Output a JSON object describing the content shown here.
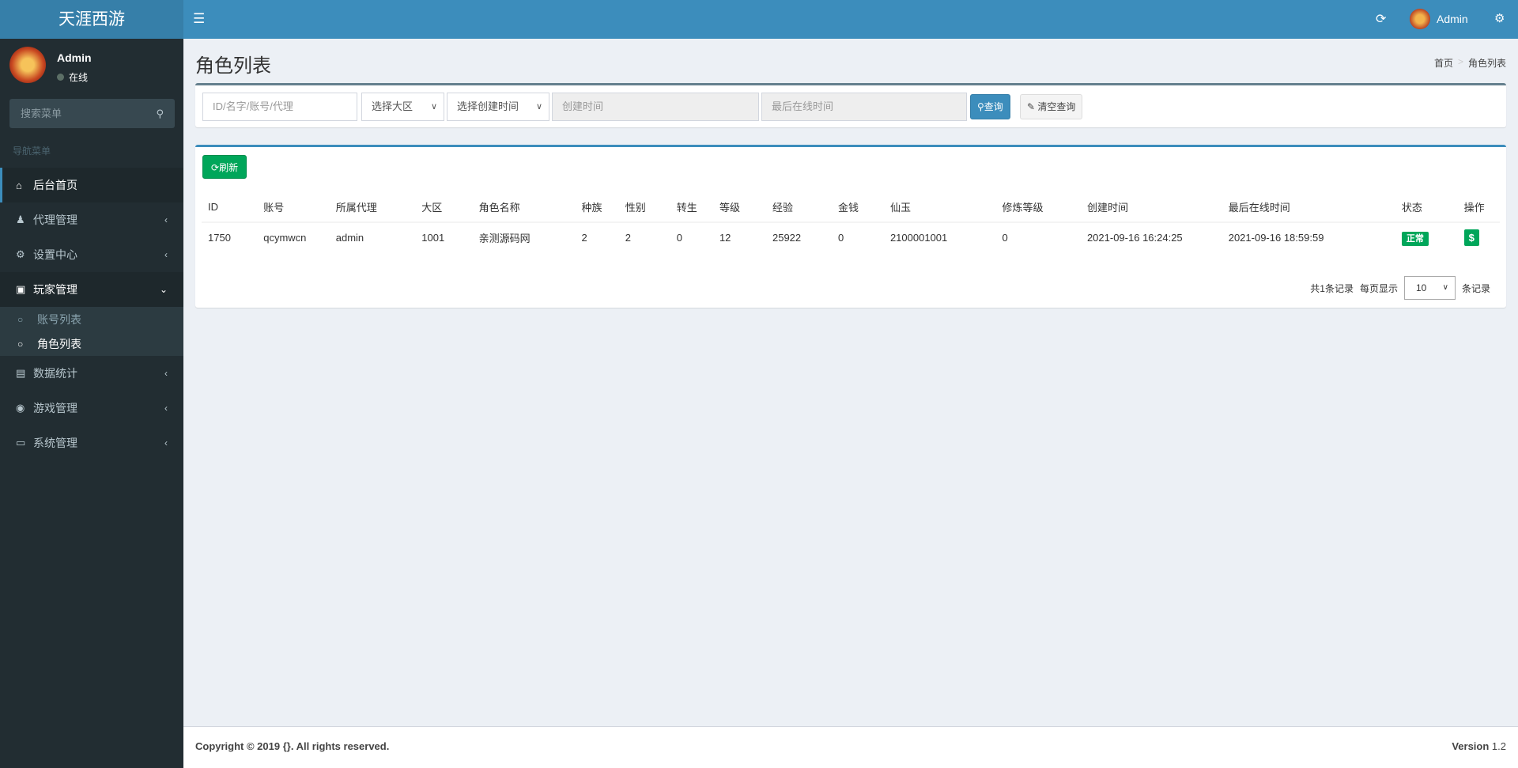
{
  "header": {
    "logo": "天涯西游",
    "user": "Admin"
  },
  "sidebar": {
    "user": {
      "name": "Admin",
      "status": "在线"
    },
    "search_placeholder": "搜索菜单",
    "section": "导航菜单",
    "items": [
      {
        "label": "后台首页",
        "icon": "home-icon"
      },
      {
        "label": "代理管理",
        "icon": "users-icon"
      },
      {
        "label": "设置中心",
        "icon": "gears-icon"
      },
      {
        "label": "玩家管理",
        "icon": "user-card-icon"
      },
      {
        "label": "数据统计",
        "icon": "area-chart-icon"
      },
      {
        "label": "游戏管理",
        "icon": "gamepad-icon"
      },
      {
        "label": "系统管理",
        "icon": "desktop-icon"
      }
    ],
    "sub_items": [
      {
        "label": "账号列表"
      },
      {
        "label": "角色列表"
      }
    ]
  },
  "page": {
    "title": "角色列表",
    "breadcrumb": [
      "首页",
      "角色列表"
    ]
  },
  "filters": {
    "keyword_placeholder": "ID/名字/账号/代理",
    "zone": "选择大区",
    "create_time_select": "选择创建时间",
    "create_time_placeholder": "创建时间",
    "last_online_placeholder": "最后在线时间",
    "search": "查询",
    "clear": "清空查询"
  },
  "toolbar": {
    "refresh": "刷新"
  },
  "table": {
    "headers": [
      "ID",
      "账号",
      "所属代理",
      "大区",
      "角色名称",
      "种族",
      "性别",
      "转生",
      "等级",
      "经验",
      "金钱",
      "仙玉",
      "修炼等级",
      "创建时间",
      "最后在线时间",
      "状态",
      "操作"
    ],
    "rows": [
      [
        "1750",
        "qcymwcn",
        "admin",
        "1001",
        "亲测源码网",
        "2",
        "2",
        "0",
        "12",
        "25922",
        "0",
        "2100001001",
        "0",
        "2021-09-16 16:24:25",
        "2021-09-16 18:59:59",
        "正常",
        "$"
      ]
    ]
  },
  "pagination": {
    "total": "共1条记录",
    "per_page_label": "每页显示",
    "per_page": "10",
    "suffix": "条记录"
  },
  "footer": {
    "copyright": "Copyright © 2019 {}. All rights reserved.",
    "version_label": "Version",
    "version": "1.2"
  },
  "colors": {
    "primary": "#3c8dbc",
    "success": "#00a65a",
    "sidebar": "#222d32"
  }
}
